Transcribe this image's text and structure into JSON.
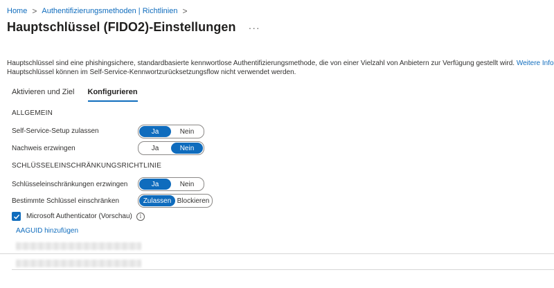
{
  "breadcrumb": {
    "items": [
      "Home",
      "Authentifizierungsmethoden | Richtlinien"
    ],
    "separator": ">"
  },
  "header": {
    "title": "Hauptschlüssel (FIDO2)-Einstellungen",
    "more_label": "···"
  },
  "description": {
    "line1": "Hauptschlüssel sind eine phishingsichere, standardbasierte kennwortlose Authentifizierungsmethode, die von einer Vielzahl von Anbietern zur Verfügung gestellt wird.",
    "link": "Weitere Informationen",
    "line2": "Hauptschlüssel können im Self-Service-Kennwortzurücksetzungsflow nicht verwendet werden."
  },
  "tabs": [
    {
      "label": "Aktivieren und Ziel",
      "active": false
    },
    {
      "label": "Konfigurieren",
      "active": true
    }
  ],
  "sections": {
    "general": "ALLGEMEIN",
    "key_restriction": "SCHLÜSSELEINSCHRÄNKUNGSRICHTLINIE"
  },
  "settings": {
    "self_service": {
      "label": "Self-Service-Setup zulassen",
      "options": [
        "Ja",
        "Nein"
      ],
      "selected": "Ja"
    },
    "attestation": {
      "label": "Nachweis erzwingen",
      "options": [
        "Ja",
        "Nein"
      ],
      "selected": "Nein"
    },
    "enforce_key_restrictions": {
      "label": "Schlüsseleinschränkungen erzwingen",
      "options": [
        "Ja",
        "Nein"
      ],
      "selected": "Ja"
    },
    "restrict_keys": {
      "label": "Bestimmte Schlüssel einschränken",
      "options": [
        "Zulassen",
        "Blockieren"
      ],
      "selected": "Zulassen"
    }
  },
  "authenticator": {
    "label": "Microsoft Authenticator (Vorschau)",
    "checked": true,
    "info_icon": "info-icon"
  },
  "add_aaguid": "AAGUID hinzufügen",
  "colors": {
    "accent": "#0f6cbd",
    "text": "#323130",
    "border": "#8a8886"
  }
}
